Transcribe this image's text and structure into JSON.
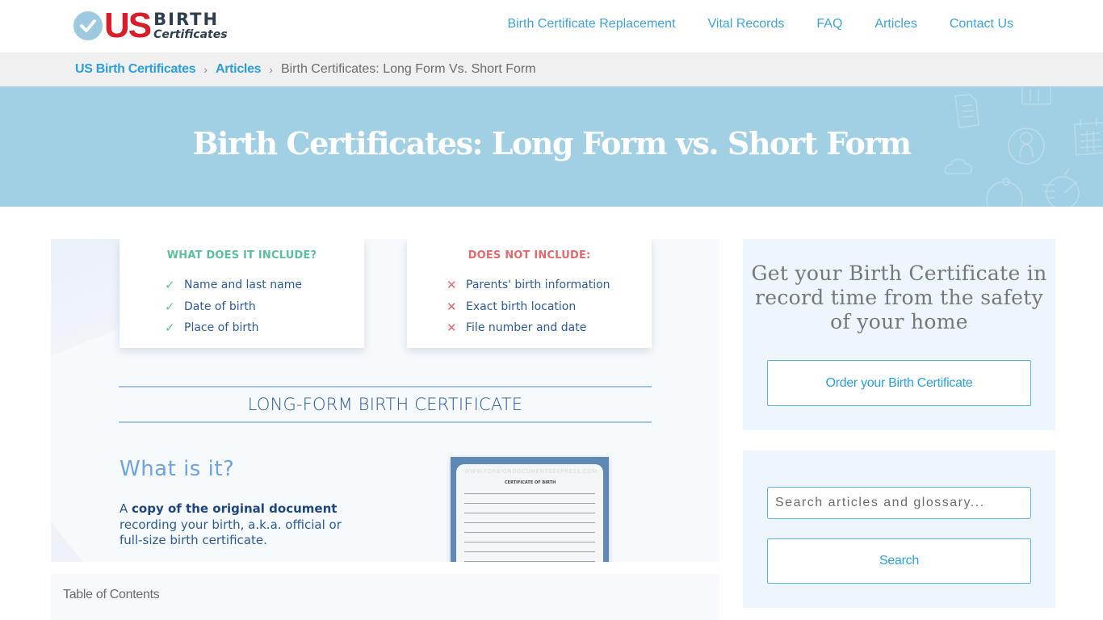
{
  "header": {
    "logo": {
      "us": "US",
      "birth": "BIRTH",
      "certificates": "Certificates",
      "icon": "check-circle-icon"
    },
    "nav": [
      {
        "label": "Birth Certificate Replacement"
      },
      {
        "label": "Vital Records"
      },
      {
        "label": "FAQ"
      },
      {
        "label": "Articles"
      },
      {
        "label": "Contact Us"
      }
    ]
  },
  "breadcrumb": {
    "items": [
      {
        "label": "US Birth Certificates"
      },
      {
        "label": "Articles"
      }
    ],
    "separator": "›",
    "current": "Birth Certificates: Long Form Vs. Short Form"
  },
  "hero": {
    "title": "Birth Certificates: Long Form vs. Short Form",
    "decorative_icons": [
      "document-icon",
      "book-icon",
      "user-circle-icon",
      "calendar-icon",
      "cloud-icon",
      "stopwatch-icon",
      "clock-icon"
    ]
  },
  "infographic": {
    "includes": {
      "title": "WHAT DOES IT INCLUDE?",
      "items": [
        "Name and last name",
        "Date of birth",
        "Place of birth"
      ],
      "mark": "✓"
    },
    "excludes": {
      "title": "DOES NOT INCLUDE:",
      "items": [
        "Parents' birth information",
        "Exact birth location",
        "File number and date"
      ],
      "mark": "✕"
    },
    "section_title": "LONG-FORM BIRTH CERTIFICATE",
    "what_heading": "What is it?",
    "desc_prefix": "A ",
    "desc_bold": "copy of the original document",
    "desc_rest": " recording your birth, a.k.a. official or full-size birth certificate.",
    "certificate_image": {
      "watermark": "WWW.FOREIGNDOCUMENTSEXPRESS.COM",
      "heading": "CERTIFICATE OF BIRTH"
    }
  },
  "toc": {
    "title": "Table of Contents"
  },
  "sidebar": {
    "cta_text": "Get your Birth Certificate in record time from the safety of your home",
    "order_button": "Order your Birth Certificate",
    "search_placeholder": "Search articles and glossary...",
    "search_value": "",
    "search_button": "Search"
  },
  "colors": {
    "brand_red": "#d71f2b",
    "link_blue": "#2d9fd8",
    "hero_bg": "#a1cfe3",
    "include_green": "#5cbf9b",
    "exclude_red": "#e26a6f",
    "sidebar_bg": "#eef6fd"
  }
}
